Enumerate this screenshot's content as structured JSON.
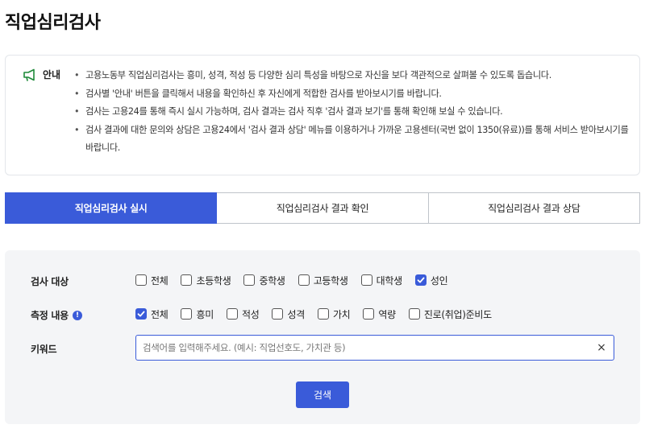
{
  "page": {
    "title": "직업심리검사"
  },
  "notice": {
    "label": "안내",
    "icon": "megaphone-icon",
    "items": [
      "고용노동부 직업심리검사는 흥미, 성격, 적성 등 다양한 심리 특성을 바탕으로 자신을 보다 객관적으로 살펴볼 수 있도록 돕습니다.",
      "검사별 '안내' 버튼을 클릭해서 내용을 확인하신 후 자신에게 적합한 검사를 받아보시기를 바랍니다.",
      "검사는 고용24를 통해 즉시 실시 가능하며, 검사 결과는 검사 직후 '검사 결과 보기'를 통해 확인해 보실 수 있습니다.",
      "검사 결과에 대한 문의와 상담은 고용24에서 '검사 결과 상담' 메뉴를 이용하거나 가까운 고용센터(국번 없이 1350(유료))를 통해 서비스 받아보시기를 바랍니다."
    ]
  },
  "tabs": [
    {
      "label": "직업심리검사 실시",
      "active": true
    },
    {
      "label": "직업심리검사 결과 확인",
      "active": false
    },
    {
      "label": "직업심리검사 결과 상담",
      "active": false
    }
  ],
  "filter": {
    "target": {
      "label": "검사 대상",
      "options": [
        {
          "label": "전체",
          "checked": false
        },
        {
          "label": "초등학생",
          "checked": false
        },
        {
          "label": "중학생",
          "checked": false
        },
        {
          "label": "고등학생",
          "checked": false
        },
        {
          "label": "대학생",
          "checked": false
        },
        {
          "label": "성인",
          "checked": true
        }
      ]
    },
    "measure": {
      "label": "측정 내용",
      "info_icon": "!",
      "options": [
        {
          "label": "전체",
          "checked": true
        },
        {
          "label": "흥미",
          "checked": false
        },
        {
          "label": "적성",
          "checked": false
        },
        {
          "label": "성격",
          "checked": false
        },
        {
          "label": "가치",
          "checked": false
        },
        {
          "label": "역량",
          "checked": false
        },
        {
          "label": "진로(취업)준비도",
          "checked": false
        }
      ]
    },
    "keyword": {
      "label": "키워드",
      "value": "",
      "placeholder": "검색어를 입력해주세요. (예시: 직업선호도, 가치관 등)",
      "clear": "×"
    },
    "search_label": "검색"
  },
  "colors": {
    "accent": "#3a5bd9",
    "panel": "#f4f5f7",
    "border": "#bfc4ca"
  }
}
